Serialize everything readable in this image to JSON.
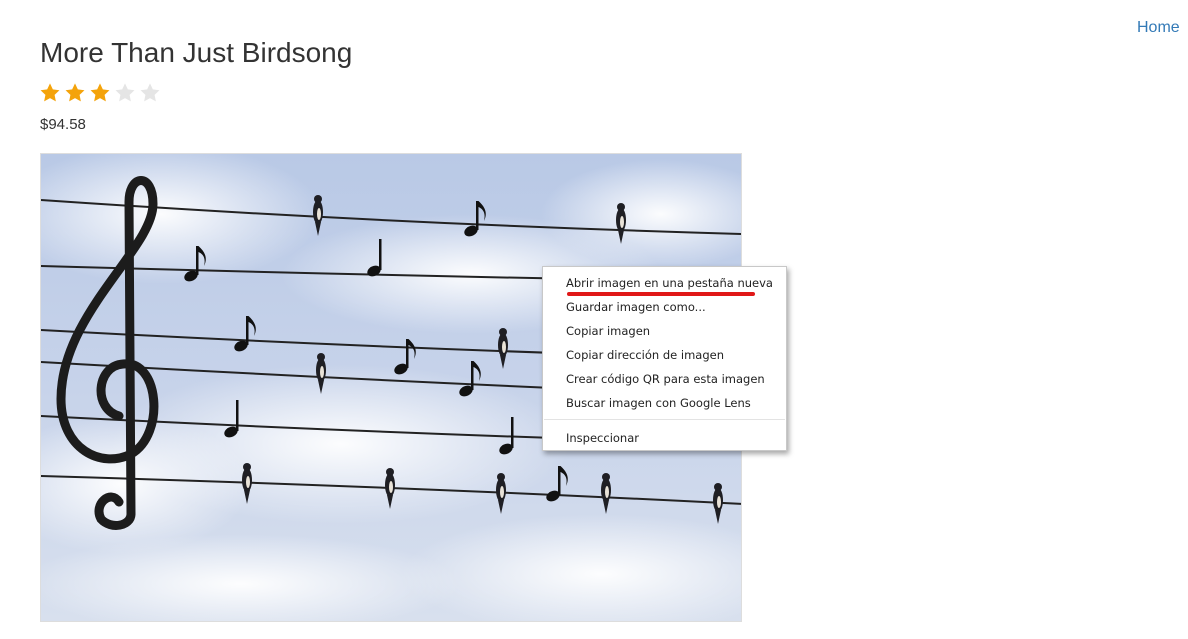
{
  "nav": {
    "home_label": "Home"
  },
  "product": {
    "title": "More Than Just Birdsong",
    "rating": {
      "value": 3,
      "max": 5
    },
    "price": "$94.58"
  },
  "colors": {
    "link": "#337ab7",
    "star_filled": "#f4a30b",
    "star_empty": "#e5e5e5",
    "annotation": "#e01818"
  },
  "context_menu": {
    "items": [
      {
        "label": "Abrir imagen en una pestaña nueva"
      },
      {
        "label": "Guardar imagen como..."
      },
      {
        "label": "Copiar imagen"
      },
      {
        "label": "Copiar dirección de imagen"
      },
      {
        "label": "Crear código QR para esta imagen"
      },
      {
        "label": "Buscar imagen con Google Lens"
      },
      {
        "label": "Inspeccionar"
      }
    ]
  }
}
